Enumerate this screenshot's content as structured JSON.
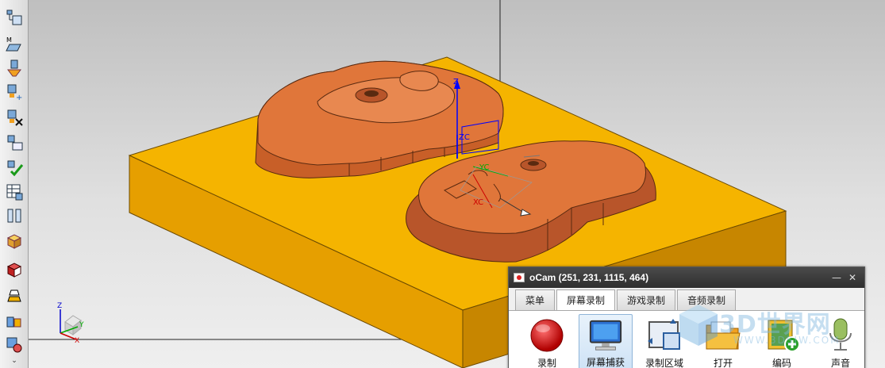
{
  "viewport": {
    "axis_labels": {
      "z": "Z",
      "y": "Y",
      "x": "X",
      "yc": "YC",
      "xc": "XC",
      "zc": "ZC"
    },
    "colors": {
      "block": "#f5b400",
      "block_side": "#c78600",
      "part": "#e0763a",
      "part_dark": "#a44e22",
      "background_top": "#bfbfbf",
      "background_bottom": "#efefef"
    }
  },
  "toolbar": {
    "buttons": [
      {
        "name": "operation-navigator-icon"
      },
      {
        "name": "machine-tool-icon"
      },
      {
        "name": "generate-toolpath-icon"
      },
      {
        "name": "insert-operation-icon"
      },
      {
        "name": "delete-toolpath-icon"
      },
      {
        "name": "list-toolpath-icon"
      },
      {
        "name": "verify-toolpath-icon"
      },
      {
        "name": "shop-documentation-icon"
      },
      {
        "name": "parallel-view-icon"
      },
      {
        "name": "feature-box-icon"
      },
      {
        "name": "part-view-icon"
      },
      {
        "name": "layer-icon"
      },
      {
        "name": "blocks-icon"
      },
      {
        "name": "tool-settings-icon"
      }
    ],
    "more_label": "⌄"
  },
  "ocam": {
    "title": "oCam (251, 231, 1115, 464)",
    "minimize": "—",
    "close": "✕",
    "tabs": [
      {
        "label": "菜单",
        "active": false
      },
      {
        "label": "屏幕录制",
        "active": true
      },
      {
        "label": "游戏录制",
        "active": false
      },
      {
        "label": "音频录制",
        "active": false
      }
    ],
    "tools": [
      {
        "label": "录制",
        "icon": "record-icon",
        "selected": false
      },
      {
        "label": "屏幕捕获",
        "icon": "screen-capture-icon",
        "selected": true
      },
      {
        "label": "录制区域",
        "icon": "record-area-icon",
        "selected": false
      },
      {
        "label": "打开",
        "icon": "open-folder-icon",
        "selected": false
      },
      {
        "label": "编码",
        "icon": "codec-icon",
        "selected": false
      },
      {
        "label": "声音",
        "icon": "microphone-icon",
        "selected": false
      }
    ]
  },
  "watermark": {
    "text": "3D世界网",
    "sub": "WWW.3DSJW.COM"
  }
}
